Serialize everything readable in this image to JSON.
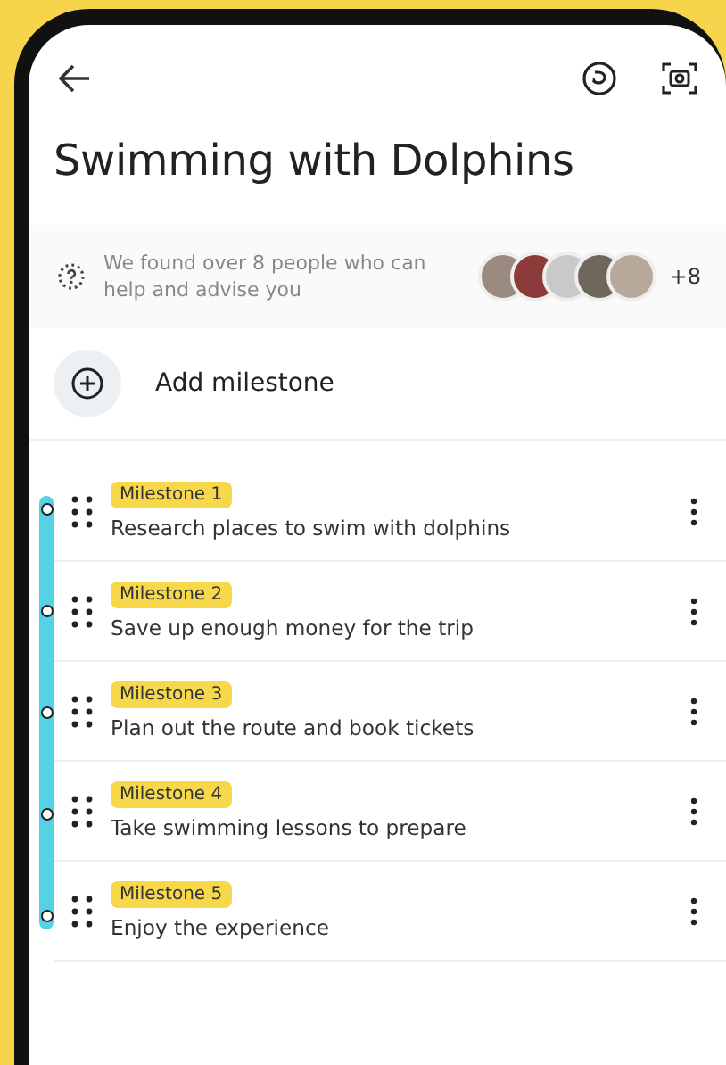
{
  "header": {
    "title": "Swimming with Dolphins"
  },
  "helpers": {
    "message": "We found over 8 people who can help and advise you",
    "more_count": "+8"
  },
  "add_button": {
    "label": "Add milestone"
  },
  "milestones": [
    {
      "badge": "Milestone 1",
      "text": "Research places to swim with dolphins"
    },
    {
      "badge": "Milestone 2",
      "text": "Save up enough money for the trip"
    },
    {
      "badge": "Milestone 3",
      "text": "Plan out the route and book tickets"
    },
    {
      "badge": "Milestone 4",
      "text": "Take swimming lessons to prepare"
    },
    {
      "badge": "Milestone 5",
      "text": "Enjoy the experience"
    }
  ]
}
